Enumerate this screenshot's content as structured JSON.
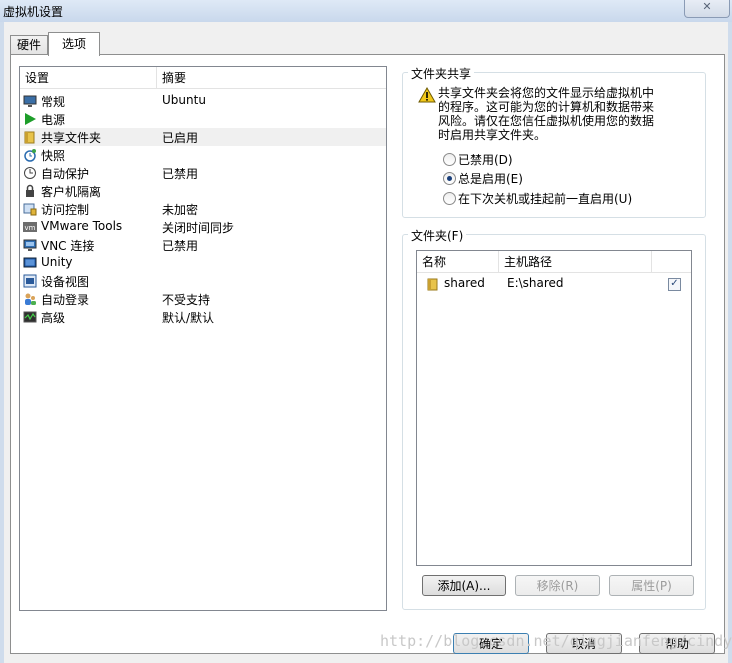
{
  "window": {
    "title": "虚拟机设置",
    "close_glyph": "✕"
  },
  "tabs": [
    {
      "label": "硬件"
    },
    {
      "label": "选项"
    }
  ],
  "settings_list": {
    "header_setting": "设置",
    "header_summary": "摘要",
    "items": [
      {
        "label": "常规",
        "summary": "Ubuntu",
        "icon": "monitor-icon"
      },
      {
        "label": "电源",
        "summary": "",
        "icon": "play-icon"
      },
      {
        "label": "共享文件夹",
        "summary": "已启用",
        "icon": "shared-folder-icon"
      },
      {
        "label": "快照",
        "summary": "",
        "icon": "snapshot-icon"
      },
      {
        "label": "自动保护",
        "summary": "已禁用",
        "icon": "autoprotect-icon"
      },
      {
        "label": "客户机隔离",
        "summary": "",
        "icon": "lock-icon"
      },
      {
        "label": "访问控制",
        "summary": "未加密",
        "icon": "access-icon"
      },
      {
        "label": "VMware Tools",
        "summary": "关闭时间同步",
        "icon": "vm-icon"
      },
      {
        "label": "VNC 连接",
        "summary": "已禁用",
        "icon": "vnc-icon"
      },
      {
        "label": "Unity",
        "summary": "",
        "icon": "unity-icon"
      },
      {
        "label": "设备视图",
        "summary": "",
        "icon": "device-view-icon"
      },
      {
        "label": "自动登录",
        "summary": "不受支持",
        "icon": "users-icon"
      },
      {
        "label": "高级",
        "summary": "默认/默认",
        "icon": "advanced-icon"
      }
    ]
  },
  "folder_sharing": {
    "title": "文件夹共享",
    "warning_lines": [
      "共享文件夹会将您的文件显示给虚拟机中",
      "的程序。这可能为您的计算机和数据带来",
      "风险。请仅在您信任虚拟机使用您的数据",
      "时启用共享文件夹。"
    ],
    "options": [
      {
        "label": "已禁用(D)",
        "selected": false
      },
      {
        "label": "总是启用(E)",
        "selected": true
      },
      {
        "label": "在下次关机或挂起前一直启用(U)",
        "selected": false
      }
    ]
  },
  "folders": {
    "title": "文件夹(F)",
    "col_name": "名称",
    "col_path": "主机路径",
    "rows": [
      {
        "name": "shared",
        "path": "E:\\shared",
        "enabled": true,
        "check": "✓"
      }
    ],
    "add_label": "添加(A)...",
    "remove_label": "移除(R)",
    "props_label": "属性(P)"
  },
  "footer": {
    "ok_label": "确定",
    "cancel_label": "取消",
    "help_label": "帮助"
  },
  "watermark": "http://blog.csdn.net/qingjianfeng/cindy"
}
